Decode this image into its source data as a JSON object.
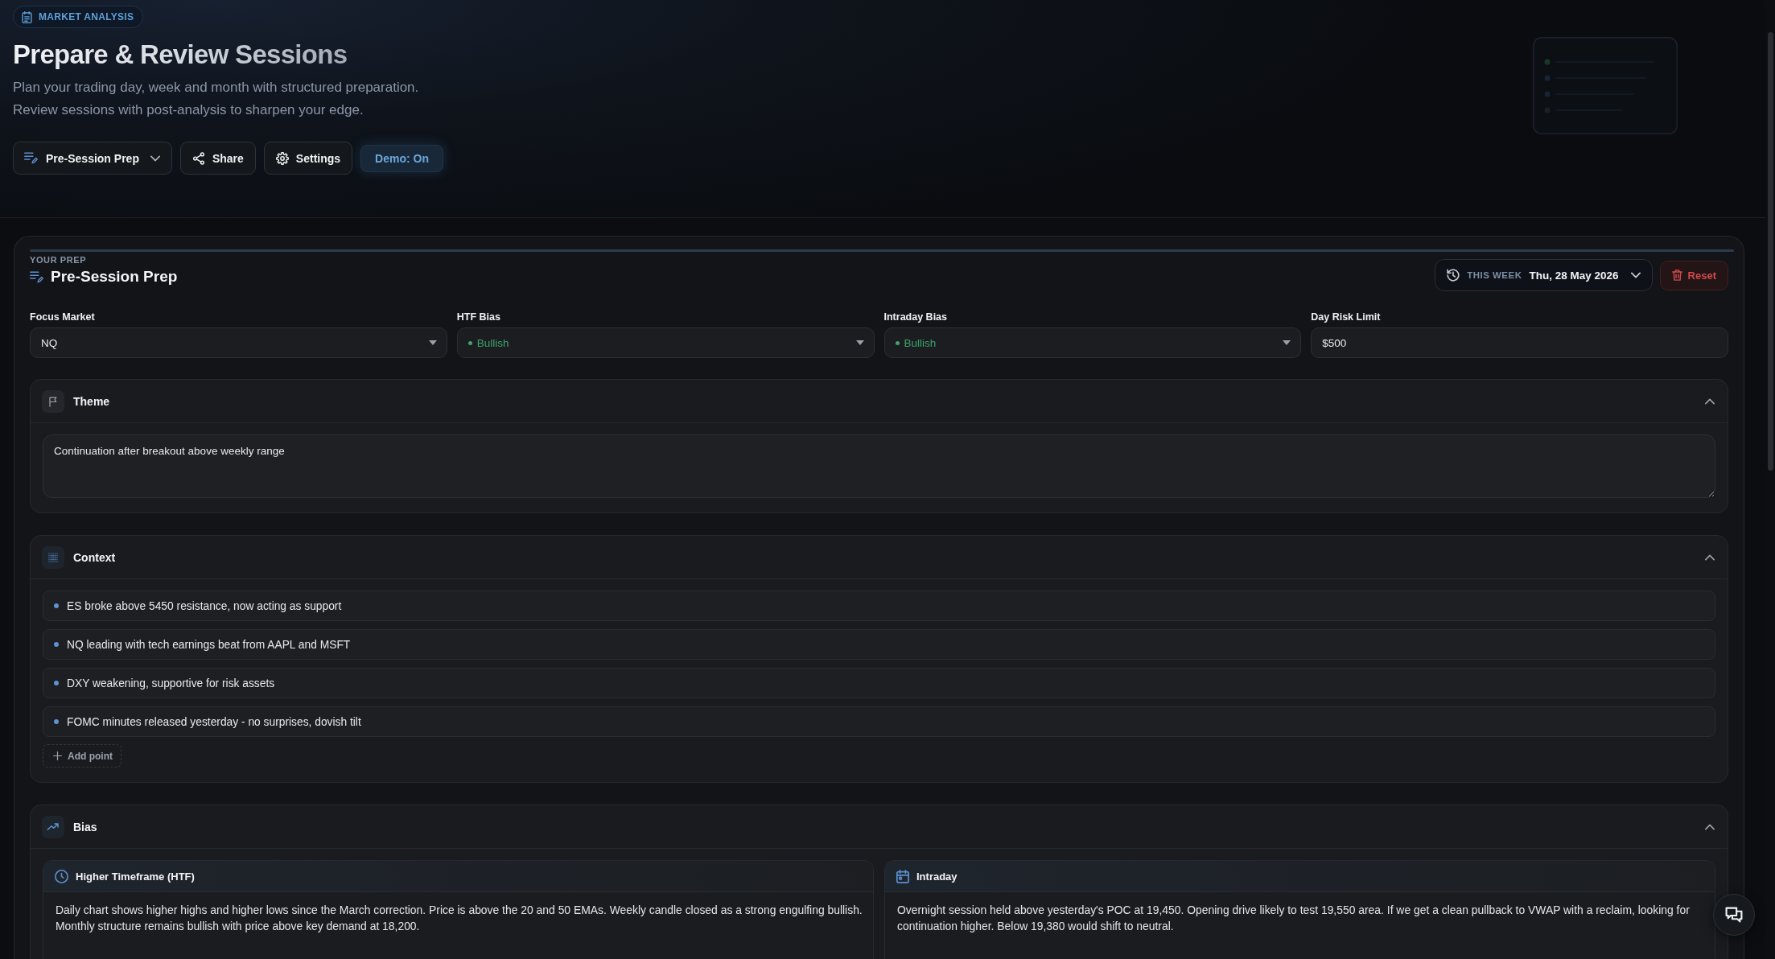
{
  "badge": {
    "label": "MARKET ANALYSIS"
  },
  "hero": {
    "title": "Prepare & Review Sessions",
    "subtitle_lines": [
      "Plan your trading day, week and month with structured preparation.",
      "Review sessions with post-analysis to sharpen your edge."
    ]
  },
  "toolbar": [
    {
      "kind": "menu",
      "label": "Pre-Session Prep"
    },
    {
      "kind": "share",
      "label": "Share"
    },
    {
      "kind": "settings",
      "label": "Settings"
    },
    {
      "kind": "toggle",
      "label": "Demo: On"
    }
  ],
  "prep": {
    "eyebrow": "YOUR PREP",
    "title": "Pre-Session Prep",
    "period": {
      "label": "THIS WEEK",
      "value": "Thu, 28 May 2026"
    },
    "reset": "Reset",
    "fields": [
      {
        "kind": "select",
        "label": "Focus Market",
        "value": "NQ"
      },
      {
        "kind": "status_select",
        "label": "HTF Bias",
        "value": "Bullish",
        "color": "#3fa36b"
      },
      {
        "kind": "status_select",
        "label": "Intraday Bias",
        "value": "Bullish",
        "color": "#3fa36b"
      },
      {
        "kind": "input",
        "label": "Day Risk Limit",
        "value": "$500"
      }
    ]
  },
  "sections": [
    {
      "kind": "text",
      "title": "Theme",
      "expanded": true,
      "value": "Continuation after breakout above weekly range"
    },
    {
      "kind": "list",
      "title": "Context",
      "expanded": true,
      "items": [
        "ES broke above 5450 resistance, now acting as support",
        "NQ leading with tech earnings beat from AAPL and MSFT",
        "DXY weakening, supportive for risk assets",
        "FOMC minutes released yesterday - no surprises, dovish tilt"
      ],
      "add_label": "Add point"
    },
    {
      "kind": "split",
      "title": "Bias",
      "expanded": true,
      "panels": [
        {
          "title": "Higher Timeframe (HTF)",
          "text": "Daily chart shows higher highs and higher lows since the March correction. Price is above the 20 and 50 EMAs. Weekly candle closed as a strong engulfing bullish. Monthly structure remains bullish with price above key demand at 18,200."
        },
        {
          "title": "Intraday",
          "text": "Overnight session held above yesterday's POC at 19,450. Opening drive likely to test 19,550 area. If we get a clean pullback to VWAP with a reclaim, looking for continuation higher. Below 19,380 would shift to neutral."
        }
      ]
    }
  ]
}
